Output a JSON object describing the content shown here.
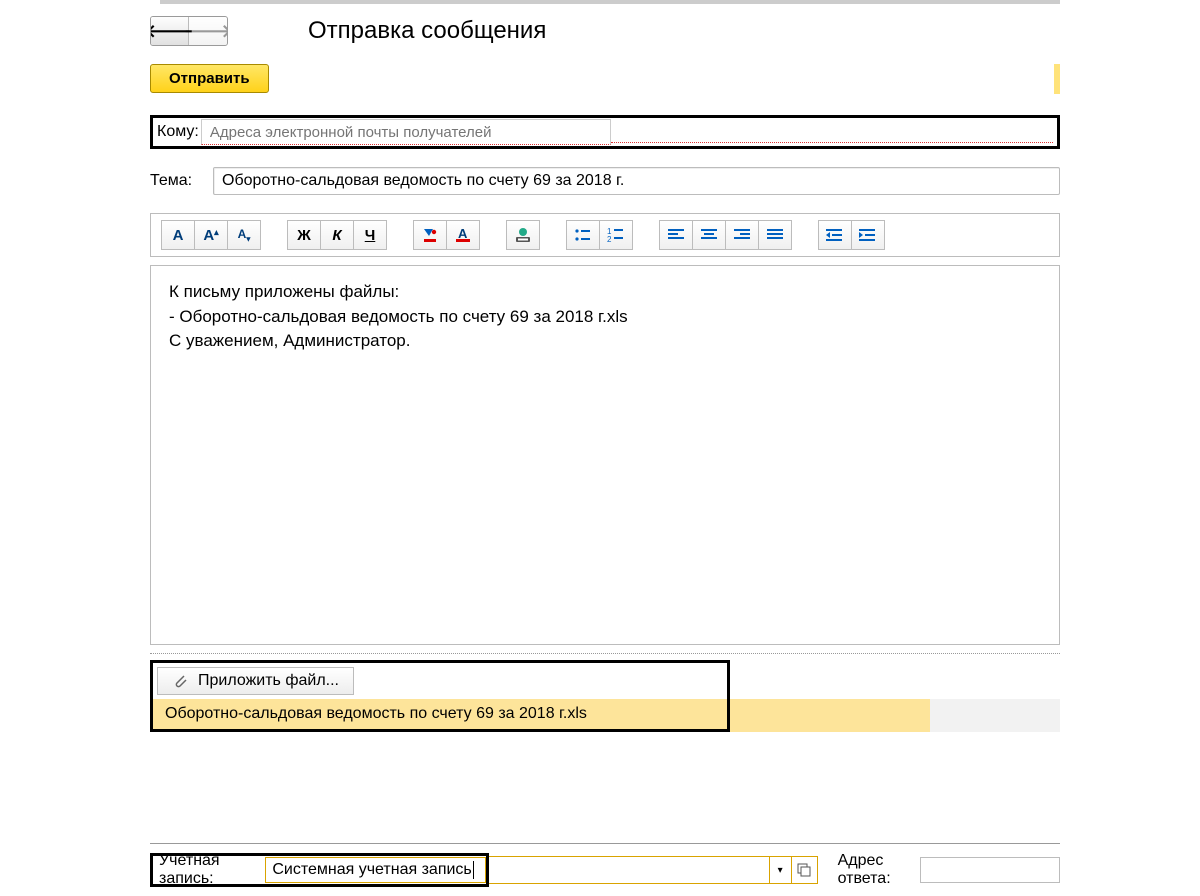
{
  "header": {
    "title": "Отправка сообщения"
  },
  "actions": {
    "send_label": "Отправить"
  },
  "fields": {
    "to_label": "Кому:",
    "to_placeholder": "Адреса электронной почты получателей",
    "subject_label": "Тема:",
    "subject_value": "Оборотно-сальдовая ведомость по счету 69 за 2018 г."
  },
  "toolbar": {
    "font_size_normal": "A",
    "font_size_big": "A",
    "font_size_small": "A",
    "bold": "Ж",
    "italic": "К",
    "underline": "Ч"
  },
  "body": {
    "line1": "К письму приложены файлы:",
    "line2": "- Оборотно-сальдовая ведомость по счету 69 за 2018 г.xls",
    "line3": "",
    "line4": "С уважением, Администратор."
  },
  "attachments": {
    "attach_label": "Приложить файл...",
    "file_name": "Оборотно-сальдовая ведомость по счету 69 за 2018 г.xls"
  },
  "footer": {
    "account_label": "Учетная запись:",
    "account_value": "Системная учетная запись",
    "reply_label": "Адрес ответа:"
  }
}
